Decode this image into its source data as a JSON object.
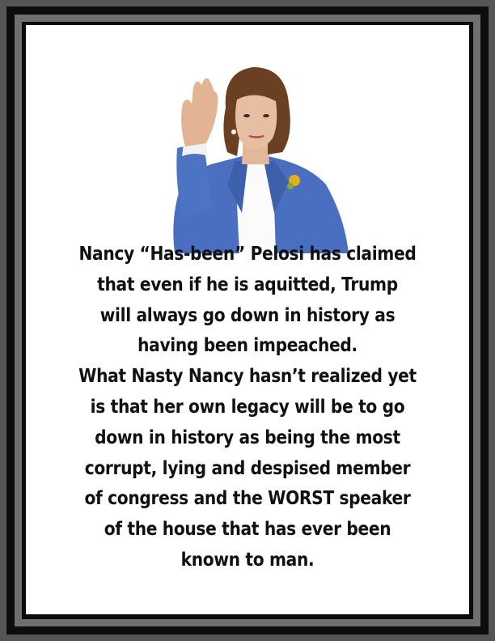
{
  "meme": {
    "lines": [
      "Nancy “Has-been” Pelosi has claimed",
      "that even if he is aquitted, Trump",
      "will always go down in history as",
      "having been impeached.",
      "What Nasty Nancy hasn’t realized yet",
      "is that her own legacy will be to go",
      "down in history as being the most",
      "corrupt, lying and despised member",
      "of congress and the WORST speaker",
      "of the house that has ever been",
      "known to man."
    ]
  },
  "colors": {
    "background": "#555555",
    "border_dark": "#0d0d0d",
    "border_gray": "#6f6f6f",
    "panel": "#ffffff",
    "text": "#111111",
    "jacket": "#4a6fc0"
  }
}
